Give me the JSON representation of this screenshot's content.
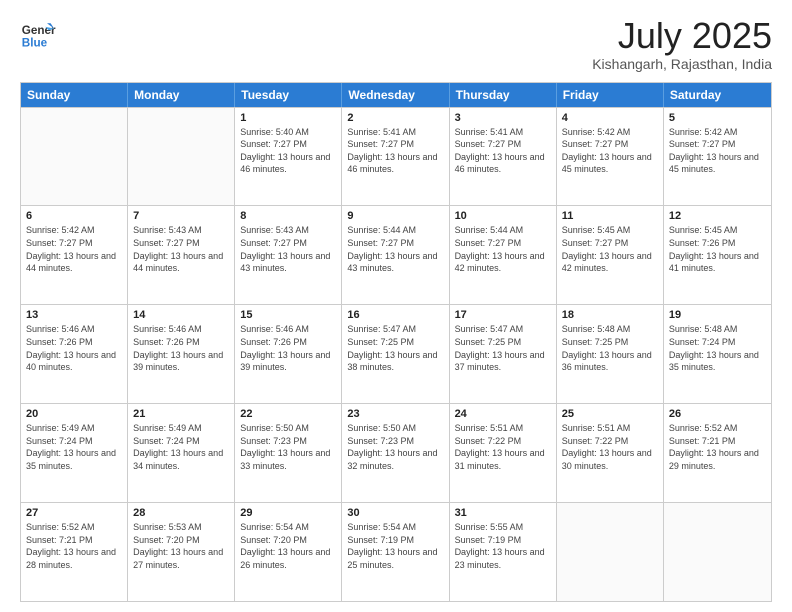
{
  "header": {
    "logo_line1": "General",
    "logo_line2": "Blue",
    "main_title": "July 2025",
    "subtitle": "Kishangarh, Rajasthan, India"
  },
  "calendar": {
    "days_of_week": [
      "Sunday",
      "Monday",
      "Tuesday",
      "Wednesday",
      "Thursday",
      "Friday",
      "Saturday"
    ],
    "weeks": [
      [
        {
          "day": "",
          "info": ""
        },
        {
          "day": "",
          "info": ""
        },
        {
          "day": "1",
          "info": "Sunrise: 5:40 AM\nSunset: 7:27 PM\nDaylight: 13 hours and 46 minutes."
        },
        {
          "day": "2",
          "info": "Sunrise: 5:41 AM\nSunset: 7:27 PM\nDaylight: 13 hours and 46 minutes."
        },
        {
          "day": "3",
          "info": "Sunrise: 5:41 AM\nSunset: 7:27 PM\nDaylight: 13 hours and 46 minutes."
        },
        {
          "day": "4",
          "info": "Sunrise: 5:42 AM\nSunset: 7:27 PM\nDaylight: 13 hours and 45 minutes."
        },
        {
          "day": "5",
          "info": "Sunrise: 5:42 AM\nSunset: 7:27 PM\nDaylight: 13 hours and 45 minutes."
        }
      ],
      [
        {
          "day": "6",
          "info": "Sunrise: 5:42 AM\nSunset: 7:27 PM\nDaylight: 13 hours and 44 minutes."
        },
        {
          "day": "7",
          "info": "Sunrise: 5:43 AM\nSunset: 7:27 PM\nDaylight: 13 hours and 44 minutes."
        },
        {
          "day": "8",
          "info": "Sunrise: 5:43 AM\nSunset: 7:27 PM\nDaylight: 13 hours and 43 minutes."
        },
        {
          "day": "9",
          "info": "Sunrise: 5:44 AM\nSunset: 7:27 PM\nDaylight: 13 hours and 43 minutes."
        },
        {
          "day": "10",
          "info": "Sunrise: 5:44 AM\nSunset: 7:27 PM\nDaylight: 13 hours and 42 minutes."
        },
        {
          "day": "11",
          "info": "Sunrise: 5:45 AM\nSunset: 7:27 PM\nDaylight: 13 hours and 42 minutes."
        },
        {
          "day": "12",
          "info": "Sunrise: 5:45 AM\nSunset: 7:26 PM\nDaylight: 13 hours and 41 minutes."
        }
      ],
      [
        {
          "day": "13",
          "info": "Sunrise: 5:46 AM\nSunset: 7:26 PM\nDaylight: 13 hours and 40 minutes."
        },
        {
          "day": "14",
          "info": "Sunrise: 5:46 AM\nSunset: 7:26 PM\nDaylight: 13 hours and 39 minutes."
        },
        {
          "day": "15",
          "info": "Sunrise: 5:46 AM\nSunset: 7:26 PM\nDaylight: 13 hours and 39 minutes."
        },
        {
          "day": "16",
          "info": "Sunrise: 5:47 AM\nSunset: 7:25 PM\nDaylight: 13 hours and 38 minutes."
        },
        {
          "day": "17",
          "info": "Sunrise: 5:47 AM\nSunset: 7:25 PM\nDaylight: 13 hours and 37 minutes."
        },
        {
          "day": "18",
          "info": "Sunrise: 5:48 AM\nSunset: 7:25 PM\nDaylight: 13 hours and 36 minutes."
        },
        {
          "day": "19",
          "info": "Sunrise: 5:48 AM\nSunset: 7:24 PM\nDaylight: 13 hours and 35 minutes."
        }
      ],
      [
        {
          "day": "20",
          "info": "Sunrise: 5:49 AM\nSunset: 7:24 PM\nDaylight: 13 hours and 35 minutes."
        },
        {
          "day": "21",
          "info": "Sunrise: 5:49 AM\nSunset: 7:24 PM\nDaylight: 13 hours and 34 minutes."
        },
        {
          "day": "22",
          "info": "Sunrise: 5:50 AM\nSunset: 7:23 PM\nDaylight: 13 hours and 33 minutes."
        },
        {
          "day": "23",
          "info": "Sunrise: 5:50 AM\nSunset: 7:23 PM\nDaylight: 13 hours and 32 minutes."
        },
        {
          "day": "24",
          "info": "Sunrise: 5:51 AM\nSunset: 7:22 PM\nDaylight: 13 hours and 31 minutes."
        },
        {
          "day": "25",
          "info": "Sunrise: 5:51 AM\nSunset: 7:22 PM\nDaylight: 13 hours and 30 minutes."
        },
        {
          "day": "26",
          "info": "Sunrise: 5:52 AM\nSunset: 7:21 PM\nDaylight: 13 hours and 29 minutes."
        }
      ],
      [
        {
          "day": "27",
          "info": "Sunrise: 5:52 AM\nSunset: 7:21 PM\nDaylight: 13 hours and 28 minutes."
        },
        {
          "day": "28",
          "info": "Sunrise: 5:53 AM\nSunset: 7:20 PM\nDaylight: 13 hours and 27 minutes."
        },
        {
          "day": "29",
          "info": "Sunrise: 5:54 AM\nSunset: 7:20 PM\nDaylight: 13 hours and 26 minutes."
        },
        {
          "day": "30",
          "info": "Sunrise: 5:54 AM\nSunset: 7:19 PM\nDaylight: 13 hours and 25 minutes."
        },
        {
          "day": "31",
          "info": "Sunrise: 5:55 AM\nSunset: 7:19 PM\nDaylight: 13 hours and 23 minutes."
        },
        {
          "day": "",
          "info": ""
        },
        {
          "day": "",
          "info": ""
        }
      ]
    ]
  }
}
